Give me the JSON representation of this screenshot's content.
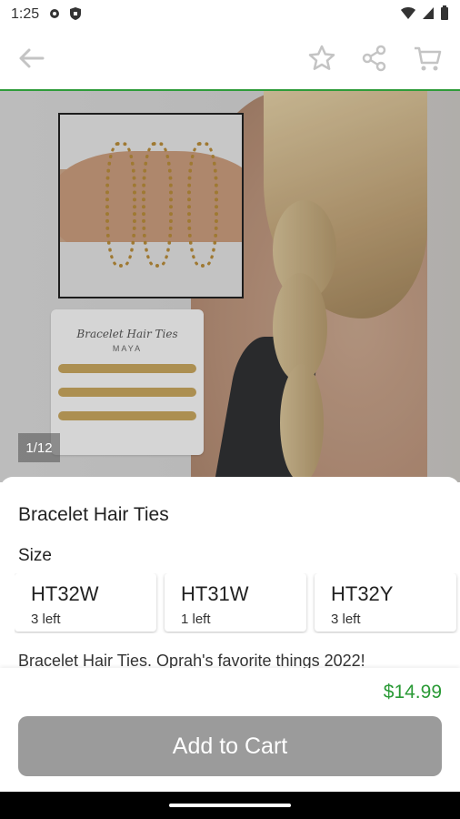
{
  "status": {
    "time": "1:25"
  },
  "hero": {
    "counter": "1/12",
    "packaging_title": "Bracelet Hair Ties",
    "packaging_brand": "MAYA"
  },
  "product": {
    "title": "Bracelet Hair Ties",
    "size_label": "Size",
    "description": "Bracelet Hair Ties. Oprah's favorite things 2022!"
  },
  "sizes": [
    {
      "code": "HT32W",
      "stock": "3 left"
    },
    {
      "code": "HT31W",
      "stock": "1 left"
    },
    {
      "code": "HT32Y",
      "stock": "3 left"
    }
  ],
  "price": "$14.99",
  "add_to_cart_label": "Add to Cart",
  "colors": {
    "accent_green": "#2a9a36",
    "button_gray": "#9b9b9b",
    "divider_green": "#2e9c3a"
  },
  "icons": [
    "settings-icon",
    "shield-icon",
    "wifi-icon",
    "signal-icon",
    "battery-icon",
    "back-arrow-icon",
    "star-icon",
    "share-icon",
    "cart-icon"
  ]
}
